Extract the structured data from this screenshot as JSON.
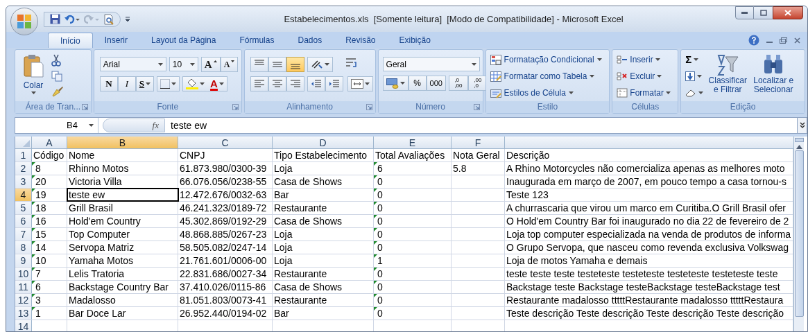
{
  "window": {
    "title": "Estabelecimentos.xls  [Somente leitura]  [Modo de Compatibilidade] - Microsoft Excel"
  },
  "ribbon_tabs": [
    {
      "label": "Início",
      "selected": true
    },
    {
      "label": "Inserir",
      "selected": false
    },
    {
      "label": "Layout da Página",
      "selected": false
    },
    {
      "label": "Fórmulas",
      "selected": false
    },
    {
      "label": "Dados",
      "selected": false
    },
    {
      "label": "Revisão",
      "selected": false
    },
    {
      "label": "Exibição",
      "selected": false
    }
  ],
  "ribbon": {
    "clipboard": {
      "label": "Área de Tran...",
      "paste": "Colar"
    },
    "font": {
      "label": "Fonte",
      "font_name": "Arial",
      "font_size": "10",
      "grow": "A",
      "shrink": "A",
      "bold": "N",
      "italic": "I",
      "underline": "S",
      "font_color": "A"
    },
    "alignment": {
      "label": "Alinhamento",
      "vertical": [
        {
          "selected": false
        },
        {
          "selected": false
        },
        {
          "selected": true
        }
      ]
    },
    "number": {
      "label": "Número",
      "format": "Geral",
      "percent": "%",
      "thousands": "000",
      "decimals": [
        {
          "top": ",0",
          "bottom": ",00"
        },
        {
          "top": ",00",
          "bottom": ",0"
        }
      ]
    },
    "styles": {
      "label": "Estilo",
      "items": [
        "Formatação Condicional",
        "Formatar como Tabela",
        "Estilos de Célula"
      ]
    },
    "cells": {
      "label": "Células",
      "items": [
        "Inserir",
        "Excluir",
        "Formatar"
      ]
    },
    "editing": {
      "label": "Edição",
      "sum": "Σ",
      "sort": "Classificar e Filtrar",
      "find": "Localizar e Selecionar"
    }
  },
  "formula_bar": {
    "name_box": "B4",
    "fx": "fx",
    "content": "teste ew"
  },
  "sheet": {
    "columns": [
      {
        "letter": "A",
        "selected": false
      },
      {
        "letter": "B",
        "selected": true
      },
      {
        "letter": "C",
        "selected": false
      },
      {
        "letter": "D",
        "selected": false
      },
      {
        "letter": "E",
        "selected": false
      },
      {
        "letter": "F",
        "selected": false
      }
    ],
    "rows": [
      {
        "number": "1",
        "selected": false,
        "flagged": false,
        "cells": [
          "Código",
          "Nome",
          "CNPJ",
          "Tipo Estabelecimento",
          "Total Avaliações",
          "Nota Geral",
          "Descrição"
        ]
      },
      {
        "number": "2",
        "selected": false,
        "flagged": true,
        "cells": [
          "8",
          "Rhinno Motos",
          "61.873.980/0300-39",
          "Loja",
          "6",
          "5.8",
          "A Rhino Motorcycles não comercializa apenas as melhores moto"
        ]
      },
      {
        "number": "3",
        "selected": false,
        "flagged": true,
        "cells": [
          "20",
          "Victoria Villa",
          "66.076.056/0238-55",
          "Casa de Shows",
          "0",
          "",
          "Inaugurada em março de 2007, em pouco tempo a casa tornou-s"
        ]
      },
      {
        "number": "4",
        "selected": true,
        "flagged": true,
        "cells": [
          "19",
          "teste ew",
          "12.472.676/0032-63",
          "Bar",
          "0",
          "",
          "Teste 123"
        ]
      },
      {
        "number": "5",
        "selected": false,
        "flagged": true,
        "cells": [
          "18",
          "Grill Brasil",
          "46.241.323/0189-72",
          "Restaurante",
          "0",
          "",
          "A churrascaria que virou um marco em Curitiba.O Grill Brasil ofer"
        ]
      },
      {
        "number": "6",
        "selected": false,
        "flagged": true,
        "cells": [
          "16",
          "Hold'em Country",
          "45.302.869/0192-29",
          "Casa de Shows",
          "0",
          "",
          "O Hold'em Country Bar foi inaugurado no dia 22 de fevereiro de 2"
        ]
      },
      {
        "number": "7",
        "selected": false,
        "flagged": true,
        "cells": [
          "15",
          "Top Computer",
          "48.868.885/0267-23",
          "Loja",
          "0",
          "",
          "Loja top computer especializada na venda de produtos de informa"
        ]
      },
      {
        "number": "8",
        "selected": false,
        "flagged": true,
        "cells": [
          "14",
          "Servopa Matriz",
          "58.505.082/0247-14",
          "Loja",
          "0",
          "",
          "O Grupo Servopa, que nasceu como revenda exclusiva Volkswag"
        ]
      },
      {
        "number": "9",
        "selected": false,
        "flagged": true,
        "cells": [
          "10",
          "Yamaha Motos",
          "21.761.601/0006-00",
          "Loja",
          "1",
          "",
          "Loja de motos Yamaha e demais"
        ]
      },
      {
        "number": "10",
        "selected": false,
        "flagged": true,
        "cells": [
          "7",
          "Lelis Tratoria",
          "22.831.686/0027-34",
          "Restaurante",
          "0",
          "",
          "teste teste teste testeteste testeteste testeteste testeteste teste"
        ]
      },
      {
        "number": "11",
        "selected": false,
        "flagged": true,
        "cells": [
          "6",
          "Backstage Country Bar",
          "37.410.026/0115-86",
          "Casa de Shows",
          "0",
          "",
          "Backstage teste Backstage testeBackstage testeBackstage test"
        ]
      },
      {
        "number": "12",
        "selected": false,
        "flagged": true,
        "cells": [
          "3",
          "Madalosso",
          "81.051.803/0073-41",
          "Restaurante",
          "0",
          "",
          "Restaurante madalosso tttttRestaurante madalosso tttttRestaura"
        ]
      },
      {
        "number": "13",
        "selected": false,
        "flagged": true,
        "cells": [
          "1",
          "Bar Doce Lar",
          "26.952.440/0194-02",
          "Bar",
          "0",
          "",
          "Teste descrição Teste descrição Teste descrição Teste descrição"
        ]
      },
      {
        "number": "14",
        "selected": false,
        "flagged": false,
        "cells": [
          "",
          "",
          "",
          "",
          "",
          "",
          ""
        ]
      }
    ]
  }
}
